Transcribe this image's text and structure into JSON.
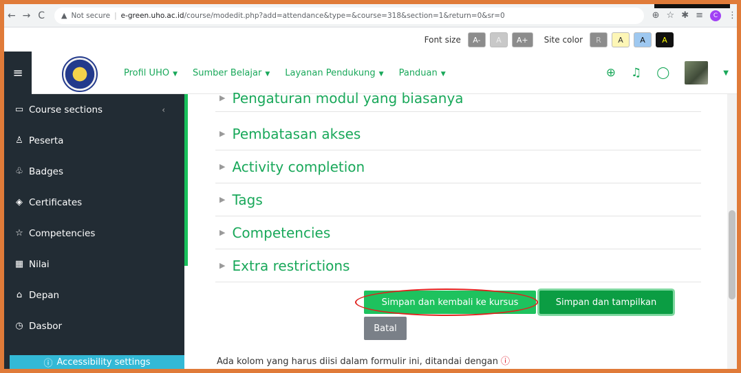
{
  "browser": {
    "back": "←",
    "forward": "→",
    "reload": "C",
    "security_label": "Not secure",
    "url_host": "e-green.uho.ac.id",
    "url_path": "/course/modedit.php?add=attendance&type=&course=318&section=1&return=0&sr=0",
    "profile_letter": "C"
  },
  "a11y_bar": {
    "font_size_label": "Font size",
    "font_decrease": "A-",
    "font_reset": "A",
    "font_increase": "A+",
    "site_color_label": "Site color",
    "color_options": [
      "R",
      "A",
      "A",
      "A"
    ]
  },
  "navbar": {
    "menu": [
      "Profil UHO",
      "Sumber Belajar",
      "Layanan Pendukung",
      "Panduan"
    ]
  },
  "sidebar": {
    "items": [
      {
        "label": "Course sections"
      },
      {
        "label": "Peserta"
      },
      {
        "label": "Badges"
      },
      {
        "label": "Certificates"
      },
      {
        "label": "Competencies"
      },
      {
        "label": "Nilai"
      },
      {
        "label": "Depan"
      },
      {
        "label": "Dasbor"
      }
    ],
    "accessibility_settings": "Accessibility settings"
  },
  "main": {
    "sections": [
      "Pengaturan modul yang biasanya",
      "Pembatasan akses",
      "Activity completion",
      "Tags",
      "Competencies",
      "Extra restrictions"
    ],
    "save_return_label": "Simpan dan kembali ke kursus",
    "save_display_label": "Simpan dan tampilkan",
    "cancel_label": "Batal",
    "required_note": "Ada kolom yang harus diisi dalam formulir ini, ditandai dengan",
    "required_icon": "ⓘ"
  },
  "colors": {
    "accent_green": "#19a85a",
    "sidebar_bg": "#222c34",
    "annotation_red": "#e0201c",
    "frame_orange": "#e07b39"
  }
}
